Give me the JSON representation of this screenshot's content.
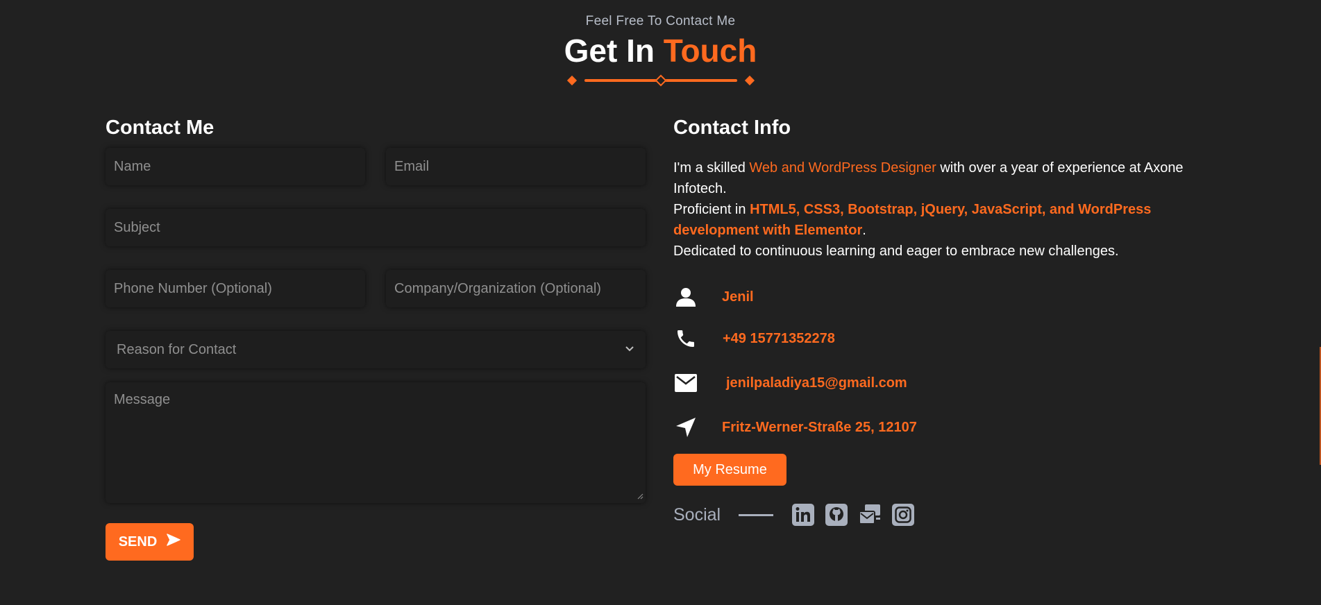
{
  "header": {
    "eyebrow": "Feel Free To Contact Me",
    "title_plain": "Get In",
    "title_accent": "Touch"
  },
  "form": {
    "heading": "Contact Me",
    "name_placeholder": "Name",
    "email_placeholder": "Email",
    "subject_placeholder": "Subject",
    "phone_placeholder": "Phone Number (Optional)",
    "company_placeholder": "Company/Organization (Optional)",
    "reason_selected": "Reason for Contact",
    "message_placeholder": "Message",
    "send_label": "SEND"
  },
  "info": {
    "heading": "Contact Info",
    "bio": {
      "p1_a": "I'm a skilled ",
      "p1_hl": "Web and WordPress Designer",
      "p1_b": " with over a year of experience at Axone Infotech.",
      "p2_a": "Proficient in ",
      "p2_hl": "HTML5, CSS3, Bootstrap, jQuery, JavaScript, and WordPress development with Elementor",
      "p2_b": ".",
      "p3": "Dedicated to continuous learning and eager to embrace new challenges."
    },
    "name": "Jenil",
    "phone": "+49 15771352278",
    "email": "jenilpaladiya15@gmail.com",
    "address": "Fritz-Werner-Straße 25, 12107",
    "resume_label": "My Resume",
    "social_label": "Social",
    "social_icons": [
      "linkedin-icon",
      "github-icon",
      "mail-icon",
      "instagram-icon"
    ]
  },
  "colors": {
    "background": "#212121",
    "accent": "#ff6a1f",
    "muted": "#a9b0bd"
  }
}
